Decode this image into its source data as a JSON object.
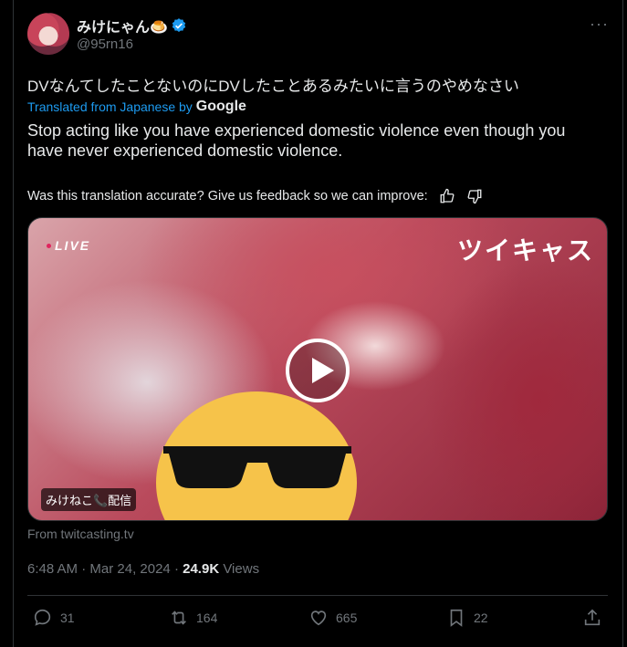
{
  "author": {
    "display_name": "みけにゃん🍮",
    "handle": "@95rn16",
    "verified": true
  },
  "more_label": "···",
  "tweet": {
    "text": "DVなんてしたことないのにDVしたことあるみたいに言うのやめなさい",
    "translated_from": "Translated from Japanese by",
    "translator": "Google",
    "translation": "Stop acting like you have experienced domestic violence even though you have never experienced domestic violence.",
    "feedback_prompt": "Was this translation accurate? Give us feedback so we can improve:"
  },
  "media": {
    "live_label": "LIVE",
    "brand_label": "ツイキャス",
    "caption": "みけねこ📞配信",
    "source": "From twitcasting.tv"
  },
  "meta": {
    "time": "6:48 AM",
    "separator1": " · ",
    "date": "Mar 24, 2024",
    "separator2": " · ",
    "views_count": "24.9K",
    "views_label": "Views"
  },
  "actions": {
    "replies": "31",
    "reposts": "164",
    "likes": "665",
    "bookmarks": "22"
  },
  "colors": {
    "accent": "#1d9bf0",
    "muted": "#71767b",
    "text": "#e7e9ea",
    "background": "#000000"
  }
}
